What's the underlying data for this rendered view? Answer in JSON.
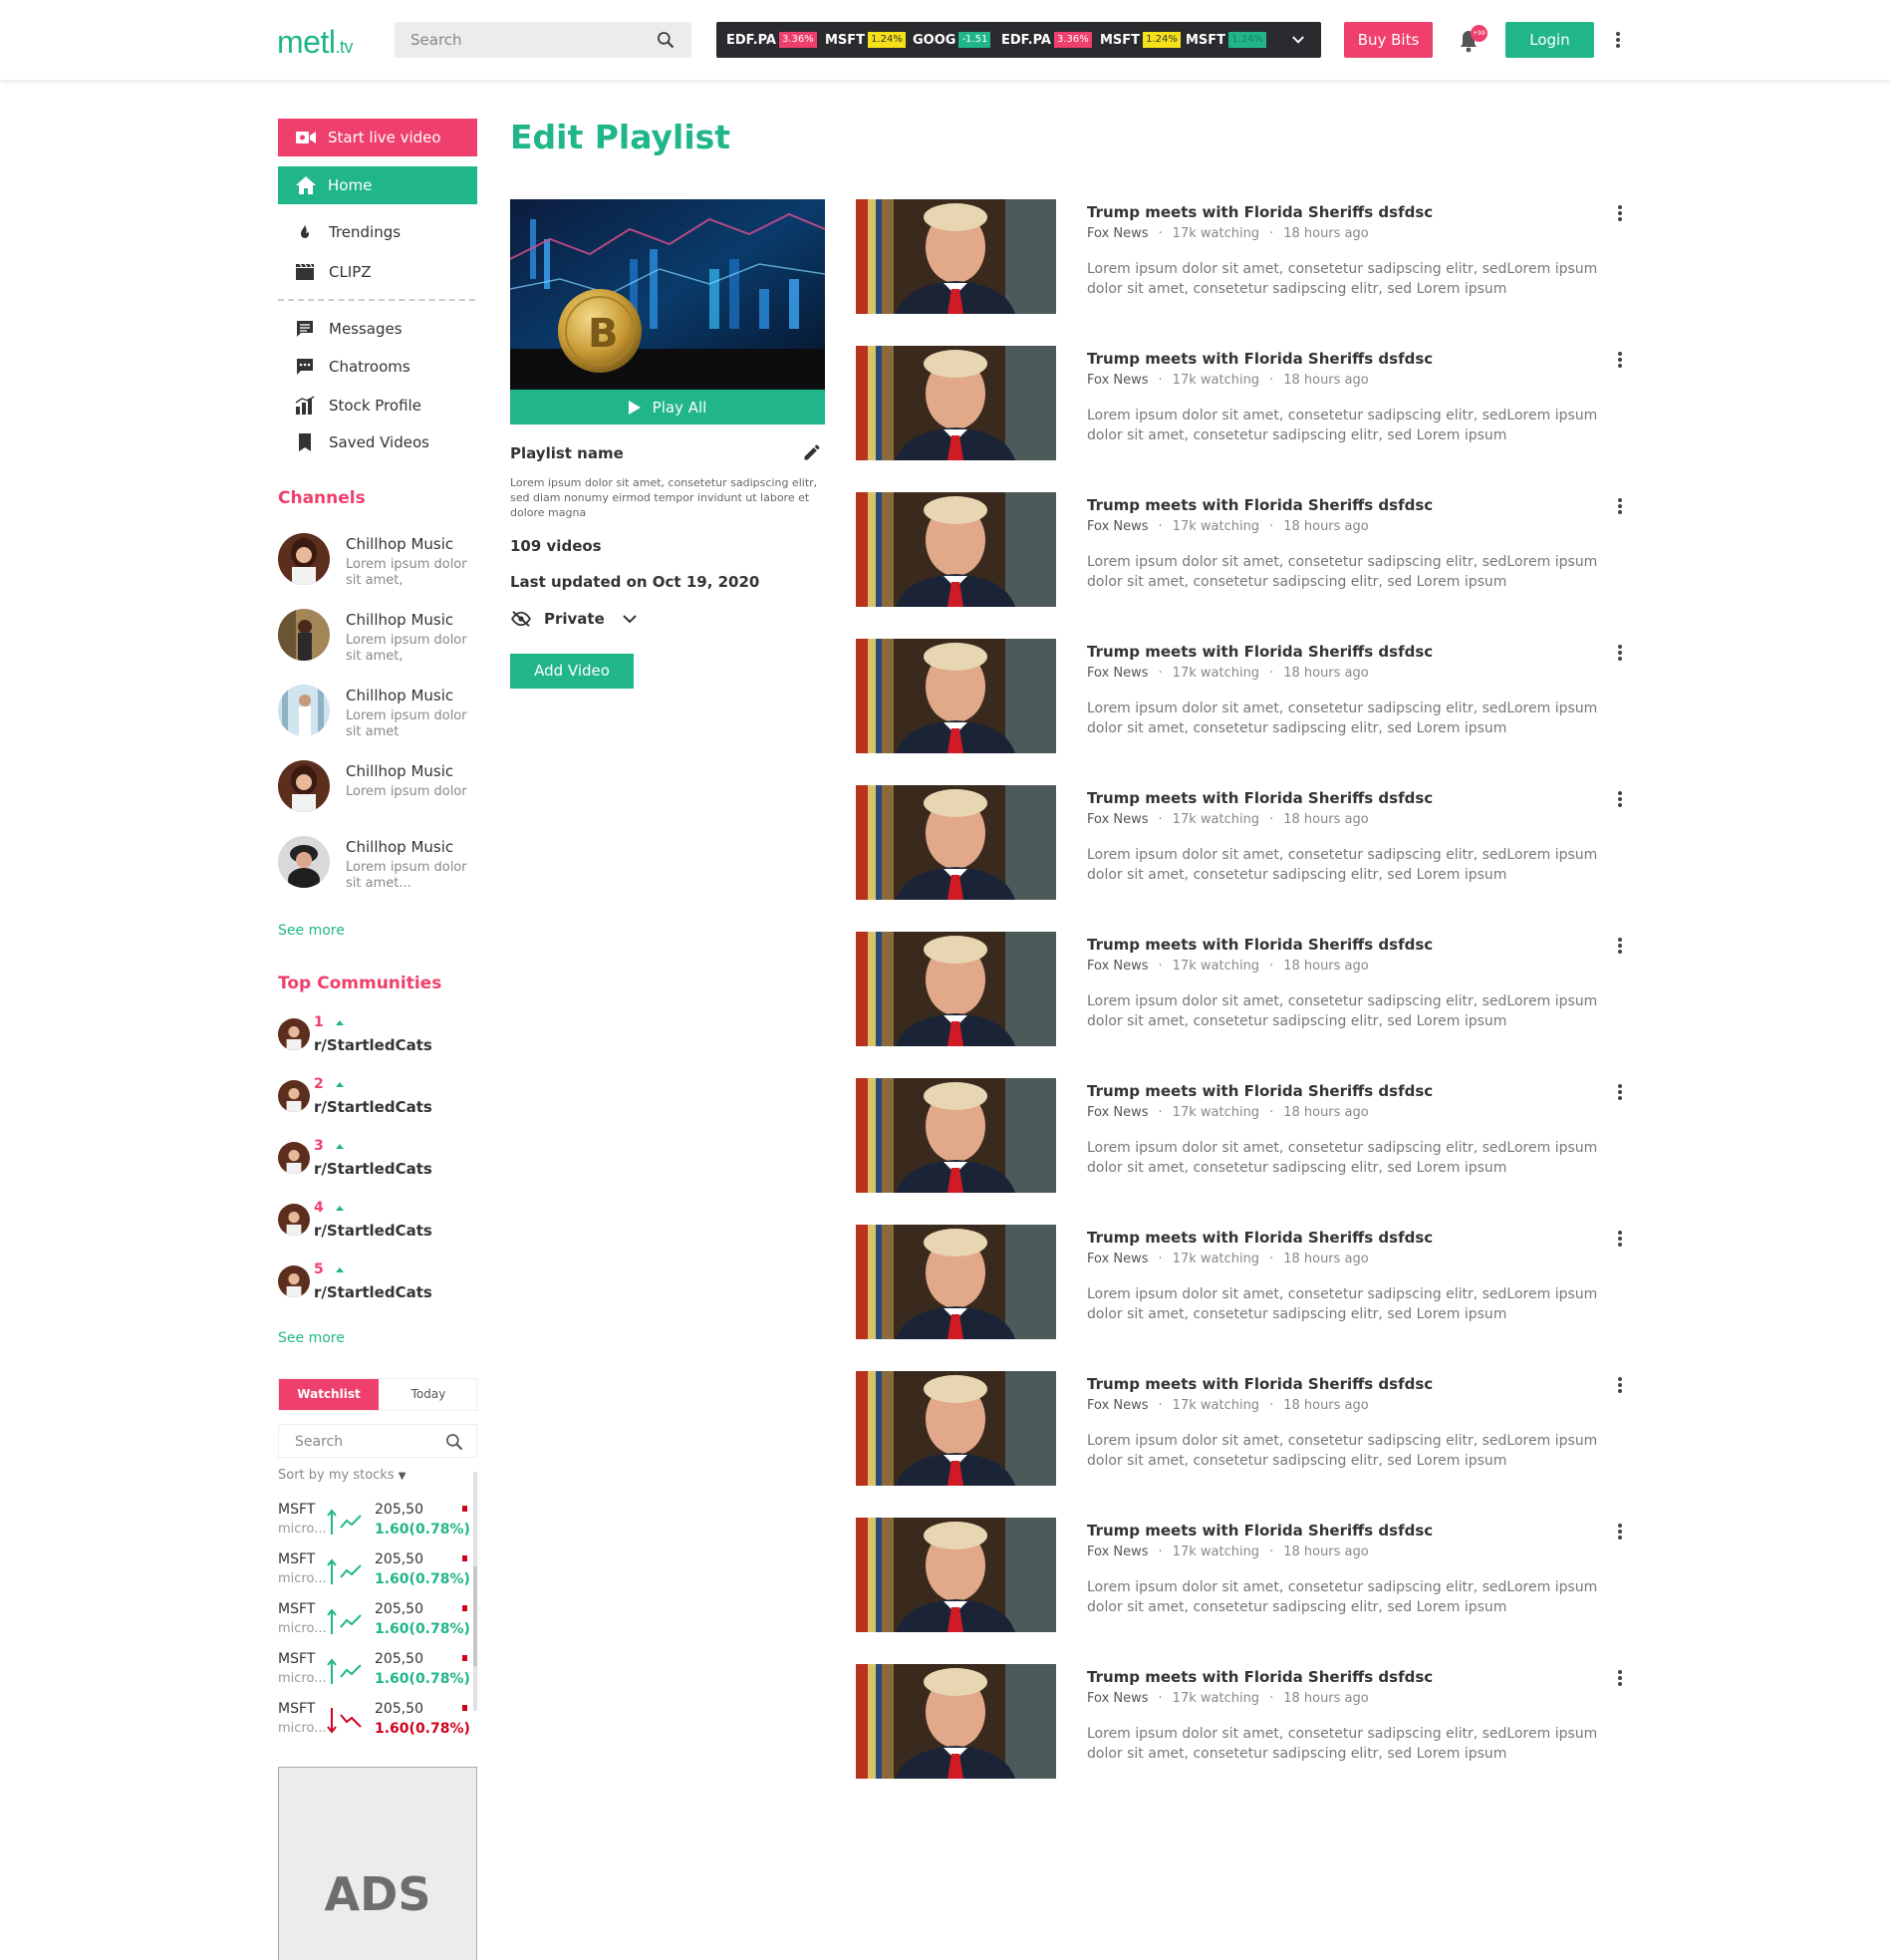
{
  "header": {
    "logo_main": "metl",
    "logo_suffix": ".tv",
    "search_placeholder": "Search",
    "ticker": [
      {
        "symbol": "EDF.PA",
        "change": "3.36%",
        "color": "#ef3f6c",
        "text_color": "#ffffff"
      },
      {
        "symbol": "MSFT",
        "change": "1.24%",
        "color": "#f5e11a",
        "text_color": "#333333"
      },
      {
        "symbol": "GOOG",
        "change": "-1.51",
        "color": "#20b68a",
        "text_color": "#ffffff"
      },
      {
        "symbol": "EDF.PA",
        "change": "3.36%",
        "color": "#ef3f6c",
        "text_color": "#ffffff"
      },
      {
        "symbol": "MSFT",
        "change": "1.24%",
        "color": "#f5e11a",
        "text_color": "#333333"
      },
      {
        "symbol": "MSFT",
        "change": "1.24%",
        "color": "#20b68a",
        "text_color": "#1e7d62"
      }
    ],
    "buy_bits_label": "Buy Bits",
    "notification_count": "+99",
    "login_label": "Login"
  },
  "sidebar": {
    "live_label": "Start live video",
    "home_label": "Home",
    "nav": [
      {
        "label": "Trendings",
        "icon": "fire-icon"
      },
      {
        "label": "CLIPZ",
        "icon": "clapperboard-icon"
      },
      {
        "label": "Messages",
        "icon": "message-icon"
      },
      {
        "label": "Chatrooms",
        "icon": "chat-icon"
      },
      {
        "label": "Stock Profile",
        "icon": "bar-chart-icon"
      },
      {
        "label": "Saved Videos",
        "icon": "bookmark-icon"
      }
    ],
    "channels_title": "Channels",
    "channels": [
      {
        "name": "Chillhop Music",
        "desc": "Lorem ipsum dolor sit amet,"
      },
      {
        "name": "Chillhop Music",
        "desc": "Lorem ipsum dolor sit amet,"
      },
      {
        "name": "Chillhop Music",
        "desc": "Lorem ipsum dolor sit amet"
      },
      {
        "name": "Chillhop Music",
        "desc": "Lorem ipsum dolor"
      },
      {
        "name": "Chillhop Music",
        "desc": "Lorem ipsum dolor sit amet..."
      }
    ],
    "see_more": "See more",
    "communities_title": "Top Communities",
    "communities": [
      {
        "rank": "1",
        "name": "r/StartledCats"
      },
      {
        "rank": "2",
        "name": "r/StartledCats"
      },
      {
        "rank": "3",
        "name": "r/StartledCats"
      },
      {
        "rank": "4",
        "name": "r/StartledCats"
      },
      {
        "rank": "5",
        "name": "r/StartledCats"
      }
    ],
    "see_more_2": "See more",
    "watchlist": {
      "tab_watchlist": "Watchlist",
      "tab_today": "Today",
      "search_placeholder": "Search",
      "sort_label": "Sort by my stocks",
      "rows": [
        {
          "symbol": "MSFT",
          "sub": "micro...",
          "price": "205,50",
          "change": "1.60(0.78%)",
          "direction": "up"
        },
        {
          "symbol": "MSFT",
          "sub": "micro...",
          "price": "205,50",
          "change": "1.60(0.78%)",
          "direction": "up"
        },
        {
          "symbol": "MSFT",
          "sub": "micro...",
          "price": "205,50",
          "change": "1.60(0.78%)",
          "direction": "up"
        },
        {
          "symbol": "MSFT",
          "sub": "micro...",
          "price": "205,50",
          "change": "1.60(0.78%)",
          "direction": "up"
        },
        {
          "symbol": "MSFT",
          "sub": "micro...",
          "price": "205,50",
          "change": "1.60(0.78%)",
          "direction": "down"
        }
      ]
    },
    "ads_label": "ADS"
  },
  "playlist": {
    "page_title": "Edit Playlist",
    "play_all_label": "Play All",
    "name_label": "Playlist name",
    "description": "Lorem ipsum dolor sit amet, consetetur sadipscing elitr, sed diam nonumy eirmod tempor invidunt ut labore et dolore magna",
    "video_count": "109 videos",
    "updated": "Last updated on Oct 19, 2020",
    "privacy": "Private",
    "add_video_label": "Add Video"
  },
  "videos": [
    {
      "title": "Trump meets with Florida Sheriffs dsfdsc",
      "channel": "Fox News",
      "watching": "17k watching",
      "time": "18 hours ago",
      "desc": "Lorem ipsum dolor sit amet, consetetur sadipscing elitr, sedLorem ipsum dolor sit amet, consetetur sadipscing elitr, sed Lorem ipsum"
    },
    {
      "title": "Trump meets with Florida Sheriffs dsfdsc",
      "channel": "Fox News",
      "watching": "17k watching",
      "time": "18 hours ago",
      "desc": "Lorem ipsum dolor sit amet, consetetur sadipscing elitr, sedLorem ipsum dolor sit amet, consetetur sadipscing elitr, sed Lorem ipsum"
    },
    {
      "title": "Trump meets with Florida Sheriffs dsfdsc",
      "channel": "Fox News",
      "watching": "17k watching",
      "time": "18 hours ago",
      "desc": "Lorem ipsum dolor sit amet, consetetur sadipscing elitr, sedLorem ipsum dolor sit amet, consetetur sadipscing elitr, sed Lorem ipsum"
    },
    {
      "title": "Trump meets with Florida Sheriffs dsfdsc",
      "channel": "Fox News",
      "watching": "17k watching",
      "time": "18 hours ago",
      "desc": "Lorem ipsum dolor sit amet, consetetur sadipscing elitr, sedLorem ipsum dolor sit amet, consetetur sadipscing elitr, sed Lorem ipsum"
    },
    {
      "title": "Trump meets with Florida Sheriffs dsfdsc",
      "channel": "Fox News",
      "watching": "17k watching",
      "time": "18 hours ago",
      "desc": "Lorem ipsum dolor sit amet, consetetur sadipscing elitr, sedLorem ipsum dolor sit amet, consetetur sadipscing elitr, sed Lorem ipsum"
    },
    {
      "title": "Trump meets with Florida Sheriffs dsfdsc",
      "channel": "Fox News",
      "watching": "17k watching",
      "time": "18 hours ago",
      "desc": "Lorem ipsum dolor sit amet, consetetur sadipscing elitr, sedLorem ipsum dolor sit amet, consetetur sadipscing elitr, sed Lorem ipsum"
    },
    {
      "title": "Trump meets with Florida Sheriffs dsfdsc",
      "channel": "Fox News",
      "watching": "17k watching",
      "time": "18 hours ago",
      "desc": "Lorem ipsum dolor sit amet, consetetur sadipscing elitr, sedLorem ipsum dolor sit amet, consetetur sadipscing elitr, sed Lorem ipsum"
    },
    {
      "title": "Trump meets with Florida Sheriffs dsfdsc",
      "channel": "Fox News",
      "watching": "17k watching",
      "time": "18 hours ago",
      "desc": "Lorem ipsum dolor sit amet, consetetur sadipscing elitr, sedLorem ipsum dolor sit amet, consetetur sadipscing elitr, sed Lorem ipsum"
    },
    {
      "title": "Trump meets with Florida Sheriffs dsfdsc",
      "channel": "Fox News",
      "watching": "17k watching",
      "time": "18 hours ago",
      "desc": "Lorem ipsum dolor sit amet, consetetur sadipscing elitr, sedLorem ipsum dolor sit amet, consetetur sadipscing elitr, sed Lorem ipsum"
    },
    {
      "title": "Trump meets with Florida Sheriffs dsfdsc",
      "channel": "Fox News",
      "watching": "17k watching",
      "time": "18 hours ago",
      "desc": "Lorem ipsum dolor sit amet, consetetur sadipscing elitr, sedLorem ipsum dolor sit amet, consetetur sadipscing elitr, sed Lorem ipsum"
    },
    {
      "title": "Trump meets with Florida Sheriffs dsfdsc",
      "channel": "Fox News",
      "watching": "17k watching",
      "time": "18 hours ago",
      "desc": "Lorem ipsum dolor sit amet, consetetur sadipscing elitr, sedLorem ipsum dolor sit amet, consetetur sadipscing elitr, sed Lorem ipsum"
    }
  ],
  "colors": {
    "brand_green": "#20b68a",
    "brand_pink": "#ef3f6c",
    "down_red": "#d0021b"
  }
}
